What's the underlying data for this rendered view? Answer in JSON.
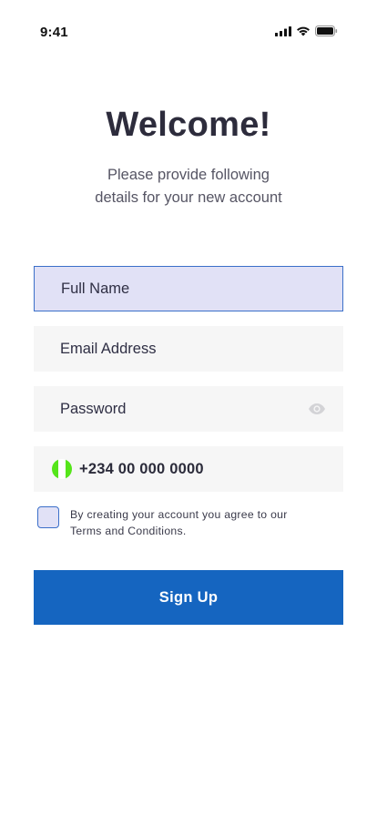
{
  "status_bar": {
    "time": "9:41"
  },
  "header": {
    "title": "Welcome!",
    "subtitle_line1": "Please provide following",
    "subtitle_line2": "details for your new account"
  },
  "form": {
    "full_name_placeholder": "Full Name",
    "email_placeholder": "Email Address",
    "password_placeholder": "Password",
    "phone_value": "+234 00 000 0000",
    "terms_line1": "By creating your account you agree to our",
    "terms_line2": "Terms and Conditions.",
    "checkbox_checked": false
  },
  "signup_button": {
    "label": "Sign Up"
  },
  "colors": {
    "primary": "#1565c0",
    "focused_field_bg": "#e1e1f6",
    "field_bg": "#f6f6f6",
    "flag_green": "#55e51a"
  },
  "icons": {
    "password_toggle": "eye-icon",
    "country_flag": "nigeria-flag-icon"
  }
}
